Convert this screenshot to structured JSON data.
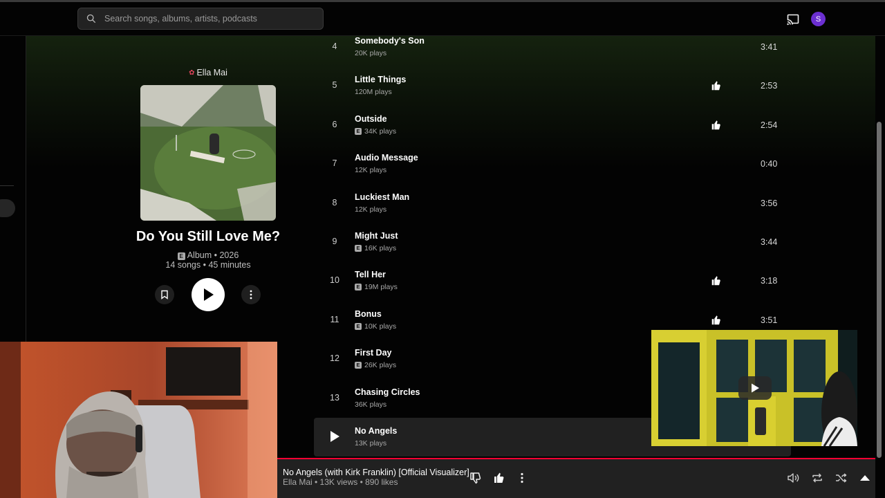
{
  "search": {
    "placeholder": "Search songs, albums, artists, podcasts"
  },
  "user": {
    "avatar_letter": "S"
  },
  "album": {
    "artist": "Ella Mai",
    "title": "Do You Still Love Me?",
    "meta_line1": "Album • 2026",
    "meta_line2": "14 songs • 45 minutes"
  },
  "tracks": [
    {
      "num": "4",
      "title": "Somebody's Son",
      "plays": "20K plays",
      "explicit": false,
      "liked": false,
      "duration": "3:41"
    },
    {
      "num": "5",
      "title": "Little Things",
      "plays": "120M plays",
      "explicit": false,
      "liked": true,
      "duration": "2:53"
    },
    {
      "num": "6",
      "title": "Outside",
      "plays": "34K plays",
      "explicit": true,
      "liked": true,
      "duration": "2:54"
    },
    {
      "num": "7",
      "title": "Audio Message",
      "plays": "12K plays",
      "explicit": false,
      "liked": false,
      "duration": "0:40"
    },
    {
      "num": "8",
      "title": "Luckiest Man",
      "plays": "12K plays",
      "explicit": false,
      "liked": false,
      "duration": "3:56"
    },
    {
      "num": "9",
      "title": "Might Just",
      "plays": "16K plays",
      "explicit": true,
      "liked": false,
      "duration": "3:44"
    },
    {
      "num": "10",
      "title": "Tell Her",
      "plays": "19M plays",
      "explicit": true,
      "liked": true,
      "duration": "3:18"
    },
    {
      "num": "11",
      "title": "Bonus",
      "plays": "10K plays",
      "explicit": true,
      "liked": true,
      "duration": "3:51"
    },
    {
      "num": "12",
      "title": "First Day",
      "plays": "26K plays",
      "explicit": true,
      "liked": false,
      "duration": ""
    },
    {
      "num": "13",
      "title": "Chasing Circles",
      "plays": "36K plays",
      "explicit": false,
      "liked": false,
      "duration": ""
    },
    {
      "num": "",
      "title": "No Angels",
      "plays": "13K plays",
      "explicit": false,
      "liked": false,
      "duration": "",
      "playing": true
    }
  ],
  "now_playing": {
    "title": "No Angels (with Kirk Franklin) [Official Visualizer]",
    "subtitle": "Ella Mai • 13K views • 890 likes",
    "progress_fraction": 1.0
  },
  "colors": {
    "accent": "#ff0033",
    "avatar": "#6b2fd1"
  },
  "icons": [
    "search-icon",
    "cast-icon",
    "bookmark-icon",
    "play-icon",
    "more-icon",
    "thumbs-up-icon",
    "thumbs-down-icon",
    "volume-icon",
    "repeat-icon",
    "shuffle-icon",
    "expand-icon"
  ]
}
